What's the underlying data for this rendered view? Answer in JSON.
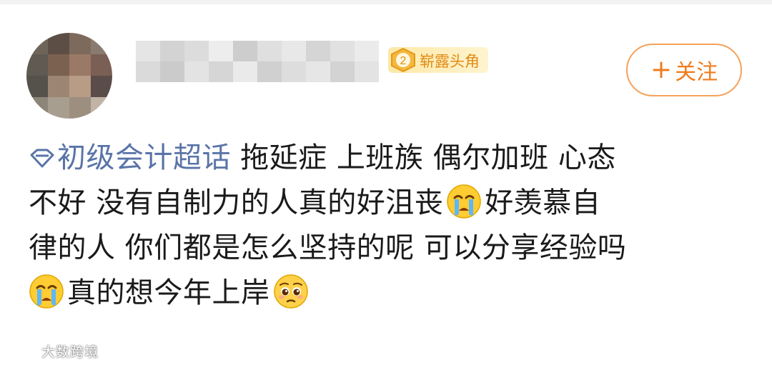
{
  "user": {
    "avatar": "blurred-avatar",
    "name": "",
    "badge": {
      "level": "2",
      "label": "崭露头角",
      "color": "#e08a12"
    }
  },
  "follow_button": {
    "icon": "plus-icon",
    "label": "关注"
  },
  "post": {
    "topic": {
      "icon": "super-topic-diamond-icon",
      "label": "初级会计超话"
    },
    "line1_text": " 拖延症 上班族 偶尔加班 心态",
    "line2_text": "不好 没有自制力的人真的好沮丧",
    "line2_after_emoji": "好羡慕自",
    "line3_text": "律的人 你们都是怎么坚持的呢 可以分享经验吗",
    "line4_text": "真的想今年上岸",
    "emojis": [
      "crying-face-emoji",
      "crying-face-emoji",
      "pleading-face-emoji"
    ]
  },
  "watermark": {
    "text": "大数跨境"
  },
  "colors": {
    "accent": "#f07b1c",
    "link": "#5a74a8",
    "text": "#1a1a1a"
  }
}
